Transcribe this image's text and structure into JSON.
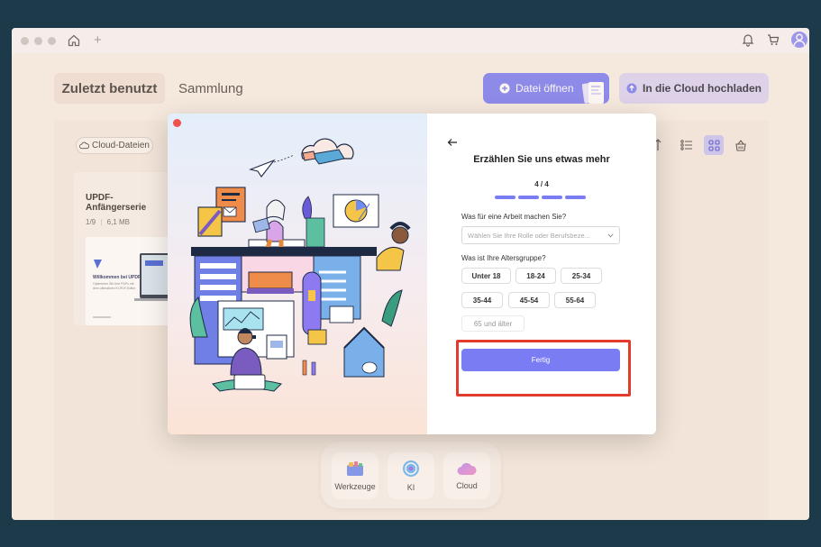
{
  "tabs": {
    "recent": "Zuletzt benutzt",
    "collection": "Sammlung"
  },
  "actions": {
    "open_file": "Datei öffnen",
    "upload_cloud": "In die Cloud hochladen"
  },
  "files": {
    "filter_chip": "Cloud-Dateien",
    "card": {
      "title": "UPDF-Anfängerserie",
      "pages": "1/9",
      "size": "6,1 MB",
      "thumb_title": "Willkommen bei UPDF",
      "thumb_subtitle": "Optimieren Sie Ihre PDFs mit dem ultimativen KI-PDF-Editor."
    }
  },
  "dock": {
    "tools": "Werkzeuge",
    "ai": "KI",
    "cloud": "Cloud"
  },
  "modal": {
    "title": "Erzählen Sie uns etwas mehr",
    "step": "4 / 4",
    "question_role": "Was für eine Arbeit machen Sie?",
    "role_placeholder": "Wählen Sie Ihre Rolle oder Berufsbeze...",
    "question_age": "Was ist Ihre Altersgruppe?",
    "age_groups": [
      "Unter 18",
      "18-24",
      "25-34",
      "35-44",
      "45-54",
      "55-64",
      "65 und älter"
    ],
    "done": "Fertig"
  },
  "colors": {
    "accent": "#7a7cf3",
    "highlight": "#e13b2d",
    "close": "#f0534f"
  },
  "icons": [
    "home-icon",
    "plus-icon",
    "bell-icon",
    "cart-icon",
    "user-icon",
    "plus-circle-icon",
    "upload-icon",
    "cloud-icon",
    "sort-icon",
    "list-view-icon",
    "grid-view-icon",
    "basket-icon",
    "back-arrow-icon",
    "chevron-down-icon",
    "toolbox-icon",
    "ai-icon"
  ]
}
